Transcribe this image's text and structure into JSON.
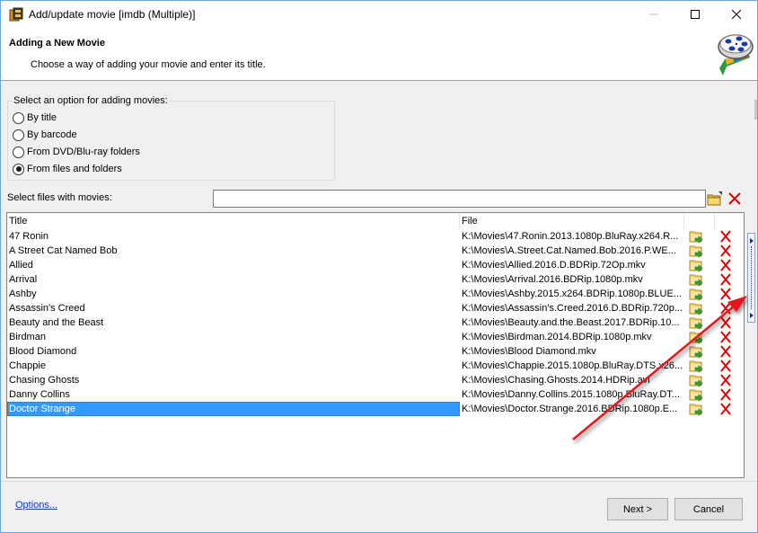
{
  "window": {
    "title": "Add/update movie [imdb (Multiple)]",
    "controls": {
      "minimize_icon": "minimize-icon",
      "maximize_icon": "maximize-icon",
      "close_icon": "close-icon"
    }
  },
  "header": {
    "title": "Adding a New Movie",
    "subtitle": "Choose a way of adding your movie and enter its title.",
    "logo_icon": "film-reel-icon"
  },
  "add_options": {
    "legend": "Select an option for adding movies:",
    "options": [
      {
        "label": "By title",
        "checked": false
      },
      {
        "label": "By barcode",
        "checked": false
      },
      {
        "label": "From DVD/Blu-ray folders",
        "checked": false
      },
      {
        "label": "From files and folders",
        "checked": true
      }
    ]
  },
  "file_select": {
    "label": "Select files with movies:",
    "value": "",
    "placeholder": "",
    "browse_icon": "folder-open-icon",
    "clear_icon": "red-x-icon"
  },
  "grid": {
    "columns": [
      "Title",
      "File",
      "",
      ""
    ],
    "selected_index": 12,
    "rows": [
      {
        "title": "47 Ronin",
        "file": "K:\\Movies\\47.Ronin.2013.1080p.BluRay.x264.R..."
      },
      {
        "title": "A Street Cat Named Bob",
        "file": "K:\\Movies\\A.Street.Cat.Named.Bob.2016.P.WE..."
      },
      {
        "title": "Allied",
        "file": "K:\\Movies\\Allied.2016.D.BDRip.72Op.mkv"
      },
      {
        "title": "Arrival",
        "file": "K:\\Movies\\Arrival.2016.BDRip.1080p.mkv"
      },
      {
        "title": "Ashby",
        "file": "K:\\Movies\\Ashby.2015.x264.BDRip.1080p.BLUE..."
      },
      {
        "title": "Assassin's Creed",
        "file": "K:\\Movies\\Assassin's.Creed.2016.D.BDRip.720p..."
      },
      {
        "title": "Beauty and the Beast",
        "file": "K:\\Movies\\Beauty.and.the.Beast.2017.BDRip.10..."
      },
      {
        "title": "Birdman",
        "file": "K:\\Movies\\Birdman.2014.BDRip.1080p.mkv"
      },
      {
        "title": "Blood Diamond",
        "file": "K:\\Movies\\Blood Diamond.mkv"
      },
      {
        "title": "Chappie",
        "file": "K:\\Movies\\Chappie.2015.1080p.BluRay.DTS.x26..."
      },
      {
        "title": "Chasing Ghosts",
        "file": "K:\\Movies\\Chasing.Ghosts.2014.HDRip.avi"
      },
      {
        "title": "Danny Collins",
        "file": "K:\\Movies\\Danny.Collins.2015.1080p.BluRay.DT..."
      },
      {
        "title": "Doctor Strange",
        "file": "K:\\Movies\\Doctor.Strange.2016.BDRip.1080p.E..."
      }
    ],
    "row_actions": {
      "open_icon": "folder-arrow-icon",
      "remove_icon": "red-x-icon"
    }
  },
  "footer": {
    "options_link": "Options...",
    "next_label": "Next >",
    "cancel_label": "Cancel"
  },
  "colors": {
    "selection": "#3399ff",
    "link": "#0b3fd1",
    "annotation_arrow": "#e8141c",
    "remove_x": "#dd0000"
  }
}
